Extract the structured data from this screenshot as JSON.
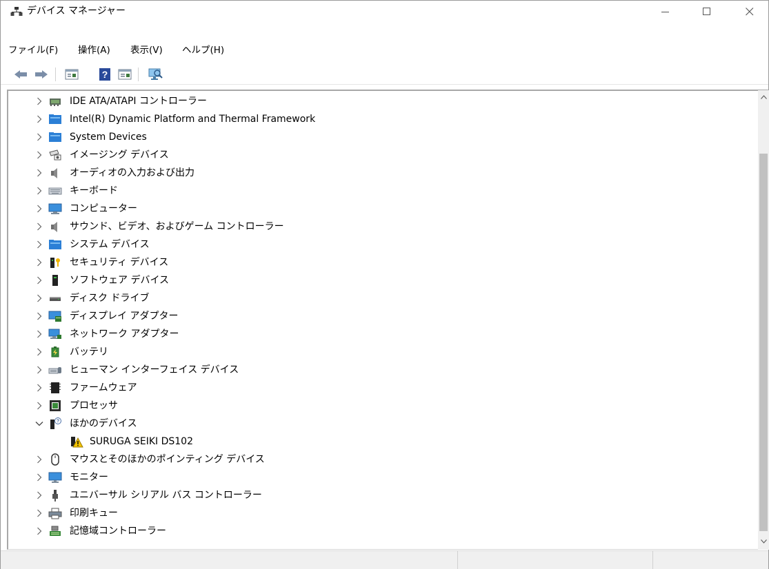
{
  "window": {
    "title": "デバイス マネージャー"
  },
  "menubar": {
    "items": [
      "ファイル(F)",
      "操作(A)",
      "表示(V)",
      "ヘルプ(H)"
    ]
  },
  "toolbar": {
    "buttons": [
      "back-icon",
      "forward-icon",
      "properties-icon",
      "help-icon",
      "view-icon",
      "scan-hardware-icon"
    ]
  },
  "tree": {
    "items": [
      {
        "label": "IDE ATA/ATAPI コントローラー",
        "icon": "ide-controller-icon",
        "expanded": false
      },
      {
        "label": "Intel(R) Dynamic Platform and Thermal Framework",
        "icon": "system-folder-icon",
        "expanded": false
      },
      {
        "label": "System Devices",
        "icon": "system-folder-icon",
        "expanded": false
      },
      {
        "label": "イメージング デバイス",
        "icon": "camera-icon",
        "expanded": false
      },
      {
        "label": "オーディオの入力および出力",
        "icon": "speaker-icon",
        "expanded": false
      },
      {
        "label": "キーボード",
        "icon": "keyboard-icon",
        "expanded": false
      },
      {
        "label": "コンピューター",
        "icon": "computer-icon",
        "expanded": false
      },
      {
        "label": "サウンド、ビデオ、およびゲーム コントローラー",
        "icon": "speaker-icon",
        "expanded": false
      },
      {
        "label": "システム デバイス",
        "icon": "system-folder-icon",
        "expanded": false
      },
      {
        "label": "セキュリティ デバイス",
        "icon": "security-key-icon",
        "expanded": false
      },
      {
        "label": "ソフトウェア デバイス",
        "icon": "software-device-icon",
        "expanded": false
      },
      {
        "label": "ディスク ドライブ",
        "icon": "disk-drive-icon",
        "expanded": false
      },
      {
        "label": "ディスプレイ アダプター",
        "icon": "display-adapter-icon",
        "expanded": false
      },
      {
        "label": "ネットワーク アダプター",
        "icon": "network-adapter-icon",
        "expanded": false
      },
      {
        "label": "バッテリ",
        "icon": "battery-icon",
        "expanded": false
      },
      {
        "label": "ヒューマン インターフェイス デバイス",
        "icon": "hid-icon",
        "expanded": false
      },
      {
        "label": "ファームウェア",
        "icon": "firmware-icon",
        "expanded": false
      },
      {
        "label": "プロセッサ",
        "icon": "processor-icon",
        "expanded": false
      },
      {
        "label": "ほかのデバイス",
        "icon": "unknown-device-icon",
        "expanded": true
      },
      {
        "label": "SURUGA SEIKI DS102",
        "icon": "warning-device-icon",
        "child": true
      },
      {
        "label": "マウスとそのほかのポインティング デバイス",
        "icon": "mouse-icon",
        "expanded": false
      },
      {
        "label": "モニター",
        "icon": "monitor-icon",
        "expanded": false
      },
      {
        "label": "ユニバーサル シリアル バス コントローラー",
        "icon": "usb-icon",
        "expanded": false
      },
      {
        "label": "印刷キュー",
        "icon": "printer-icon",
        "expanded": false
      },
      {
        "label": "記憶域コントローラー",
        "icon": "storage-controller-icon",
        "expanded": false
      }
    ]
  },
  "colors": {
    "accent": "#1e78d0",
    "folder": "#2b7fd6",
    "warning": "#f5c400"
  }
}
